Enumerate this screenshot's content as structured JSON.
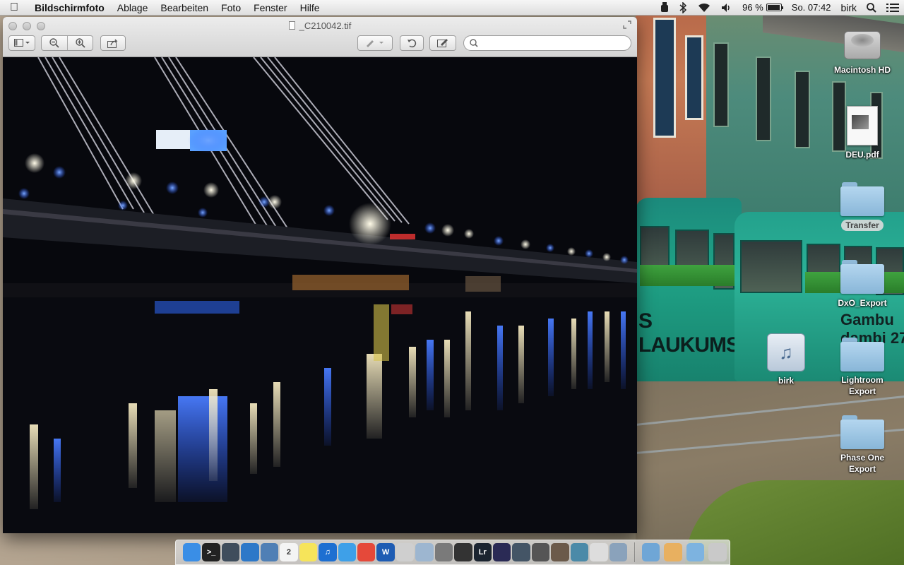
{
  "menubar": {
    "apple_icon": "apple-icon",
    "app_name": "Bildschirmfoto",
    "menus": [
      "Ablage",
      "Bearbeiten",
      "Foto",
      "Fenster",
      "Hilfe"
    ],
    "battery_percent": "96 %",
    "battery_level": 0.96,
    "clock": "So. 07:42",
    "user": "birk",
    "status_icons": [
      "lighting-icon",
      "bluetooth-icon",
      "wifi-icon",
      "volume-icon",
      "battery-icon",
      "spotlight-icon",
      "notification-center-icon"
    ]
  },
  "window": {
    "title": "_C210042.tif",
    "toolbar": {
      "sidebar_icon": "sidebar-view-icon",
      "zoom_out_icon": "zoom-out-icon",
      "zoom_in_icon": "zoom-in-icon",
      "share_icon": "share-icon",
      "annotate_icon": "pen-icon",
      "rotate_icon": "rotate-left-icon",
      "edit_icon": "edit-toolbar-icon",
      "search_placeholder": ""
    }
  },
  "photo": {
    "subject": "night-bridge-river-reflections",
    "sky_color": "#07080d",
    "water_color": "#0a0a10",
    "light_blue": "#3b7bff",
    "light_warm": "#ffe7b0"
  },
  "wallpaper": {
    "tram_text_1": "S LAUKUMS",
    "tram_text_2": "Gambu dambi 27"
  },
  "desktop_icons": [
    {
      "label": "Macintosh HD",
      "kind": "hard-disk-icon"
    },
    {
      "label": "DEU.pdf",
      "kind": "pdf-icon"
    },
    {
      "label": "Transfer",
      "kind": "folder-icon"
    },
    {
      "label": "DxO_Export",
      "kind": "folder-icon"
    },
    {
      "label": "birk",
      "kind": "home-folder-icon"
    },
    {
      "label": "Lightroom Export",
      "kind": "folder-icon"
    },
    {
      "label": "Phase One Export",
      "kind": "folder-icon"
    }
  ],
  "dock": {
    "apps": [
      {
        "name": "finder-icon",
        "color": "#3a8ee6",
        "glyph": ""
      },
      {
        "name": "terminal-icon",
        "color": "#222222",
        "glyph": ">_"
      },
      {
        "name": "mission-control-icon",
        "color": "#3f4d5c",
        "glyph": ""
      },
      {
        "name": "safari-icon",
        "color": "#2d78c8",
        "glyph": ""
      },
      {
        "name": "preview-icon",
        "color": "#4f7fb5",
        "glyph": ""
      },
      {
        "name": "calendar-icon",
        "color": "#f4f4f4",
        "glyph": "2"
      },
      {
        "name": "stickies-icon",
        "color": "#f6e45a",
        "glyph": ""
      },
      {
        "name": "itunes-icon",
        "color": "#1d6fd1",
        "glyph": "♫"
      },
      {
        "name": "safari-compass-icon",
        "color": "#3ea0e8",
        "glyph": ""
      },
      {
        "name": "chrome-icon",
        "color": "#e5493a",
        "glyph": ""
      },
      {
        "name": "word-icon",
        "color": "#1e5cb3",
        "glyph": "W"
      },
      {
        "name": "camera-icon",
        "color": "#cfcfcf",
        "glyph": ""
      },
      {
        "name": "photos-icon",
        "color": "#9db6d0",
        "glyph": ""
      },
      {
        "name": "image-capture-icon",
        "color": "#7a7a7a",
        "glyph": ""
      },
      {
        "name": "nikon-icon",
        "color": "#333333",
        "glyph": ""
      },
      {
        "name": "lightroom-icon",
        "color": "#1b2430",
        "glyph": "Lr"
      },
      {
        "name": "dxo-icon",
        "color": "#2a2a55",
        "glyph": ""
      },
      {
        "name": "aperture-icon",
        "color": "#445566",
        "glyph": ""
      },
      {
        "name": "capture-one-icon",
        "color": "#555555",
        "glyph": ""
      },
      {
        "name": "photo-app-icon",
        "color": "#6b5a4a",
        "glyph": ""
      },
      {
        "name": "landscape-icon",
        "color": "#4b8aa8",
        "glyph": ""
      },
      {
        "name": "xnview-icon",
        "color": "#dddddd",
        "glyph": ""
      },
      {
        "name": "iphoto-icon",
        "color": "#8aa2bb",
        "glyph": ""
      }
    ],
    "stacks": [
      {
        "name": "applications-stack-icon",
        "color": "#6fa6d6"
      },
      {
        "name": "home-stack-icon",
        "color": "#e8b060"
      },
      {
        "name": "downloads-stack-icon",
        "color": "#7db3e0"
      },
      {
        "name": "trash-icon",
        "color": "#c9c9c9"
      }
    ]
  }
}
